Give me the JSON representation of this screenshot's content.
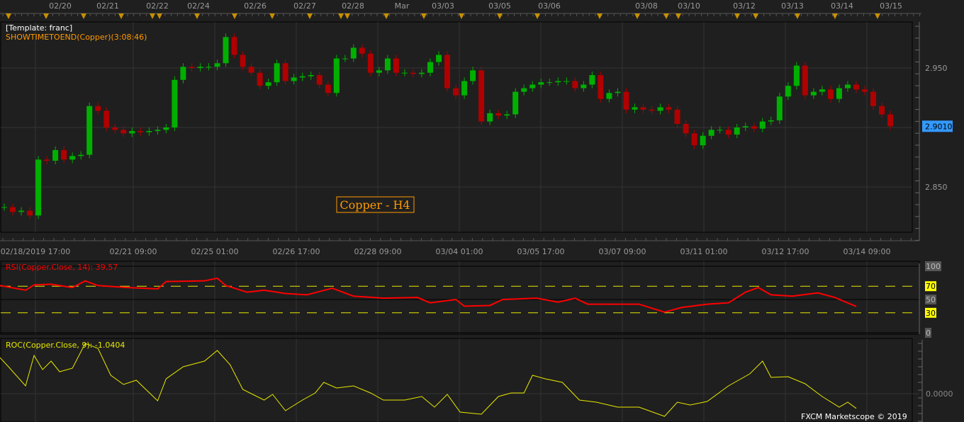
{
  "template_label": "[Template: franc]",
  "timer_label": "SHOWTIMETOEND(Copper)(3:08:46)",
  "chart_title": "Copper - H4",
  "copyright": "FXCM Marketscope © 2019",
  "colors": {
    "background": "#1f1f1f",
    "up": "#00b000",
    "down": "#b00000",
    "rsi": "#ff0000",
    "roc": "#e8e800",
    "level": "#e8e800",
    "price_tag": "#3399ff",
    "title": "#ff9900"
  },
  "top_dates": [
    "02/20",
    "02/21",
    "02/22",
    "02/24",
    "02/26",
    "02/27",
    "02/28",
    "Mar",
    "03/03",
    "03/05",
    "03/06",
    "03/08",
    "03/10",
    "03/12",
    "03/13",
    "03/14",
    "03/15"
  ],
  "chart_data": [
    {
      "type": "candlestick",
      "symbol": "Copper",
      "timeframe": "H4",
      "y_ticks": [
        "2.950",
        "2.900",
        "2.850"
      ],
      "ylim": [
        2.815,
        2.99
      ],
      "last_price": "2.9010",
      "x_labels": [
        "02/18/2019 17:00",
        "02/21 09:00",
        "02/25 01:00",
        "02/26 17:00",
        "02/28 09:00",
        "03/04 01:00",
        "03/05 17:00",
        "03/07 09:00",
        "03/11 01:00",
        "03/12 17:00",
        "03/14 09:00"
      ],
      "first_open": 2.833,
      "closes": [
        2.833,
        2.829,
        2.83,
        2.826,
        2.873,
        2.872,
        2.881,
        2.873,
        2.876,
        2.877,
        2.918,
        2.914,
        2.9,
        2.898,
        2.895,
        2.897,
        2.896,
        2.897,
        2.898,
        2.9,
        2.94,
        2.951,
        2.95,
        2.951,
        2.951,
        2.954,
        2.976,
        2.961,
        2.951,
        2.946,
        2.935,
        2.938,
        2.954,
        2.939,
        2.942,
        2.943,
        2.944,
        2.936,
        2.929,
        2.958,
        2.958,
        2.967,
        2.962,
        2.946,
        2.948,
        2.958,
        2.946,
        2.946,
        2.945,
        2.946,
        2.955,
        2.961,
        2.933,
        2.927,
        2.939,
        2.948,
        2.905,
        2.912,
        2.91,
        2.911,
        2.93,
        2.933,
        2.936,
        2.938,
        2.938,
        2.939,
        2.939,
        2.933,
        2.936,
        2.944,
        2.924,
        2.929,
        2.93,
        2.915,
        2.917,
        2.915,
        2.914,
        2.917,
        2.915,
        2.903,
        2.895,
        2.885,
        2.893,
        2.898,
        2.898,
        2.894,
        2.9,
        2.901,
        2.899,
        2.905,
        2.906,
        2.926,
        2.935,
        2.952,
        2.927,
        2.93,
        2.932,
        2.924,
        2.933,
        2.936,
        2.932,
        2.93,
        2.918,
        2.911,
        2.901
      ]
    },
    {
      "type": "line",
      "label": "RSI(Copper.Close, 14): 39.57",
      "y_ticks": [
        "100",
        "70",
        "50",
        "30",
        "0"
      ],
      "ylim": [
        0,
        100
      ],
      "levels": [
        70,
        30
      ],
      "points": [
        [
          -0.5,
          71
        ],
        [
          2.5,
          64
        ],
        [
          3.5,
          72
        ],
        [
          5.5,
          73
        ],
        [
          8,
          68
        ],
        [
          9.5,
          78
        ],
        [
          11,
          71
        ],
        [
          14.5,
          68
        ],
        [
          18,
          66
        ],
        [
          19,
          77
        ],
        [
          23.5,
          78
        ],
        [
          25,
          82
        ],
        [
          26,
          71
        ],
        [
          28.5,
          61
        ],
        [
          30.5,
          64
        ],
        [
          33,
          59
        ],
        [
          35.5,
          57
        ],
        [
          38.5,
          67
        ],
        [
          41,
          55
        ],
        [
          44.5,
          52
        ],
        [
          48.5,
          53
        ],
        [
          50,
          45
        ],
        [
          53,
          50
        ],
        [
          54,
          40
        ],
        [
          57,
          41
        ],
        [
          58.5,
          50
        ],
        [
          62.5,
          52
        ],
        [
          65,
          46
        ],
        [
          67,
          52
        ],
        [
          68.5,
          43
        ],
        [
          74.5,
          43
        ],
        [
          77.5,
          31
        ],
        [
          79.5,
          38
        ],
        [
          82.5,
          43
        ],
        [
          85,
          45
        ],
        [
          87,
          61
        ],
        [
          88.5,
          68
        ],
        [
          90,
          57
        ],
        [
          92.5,
          55
        ],
        [
          95.5,
          60
        ],
        [
          97.5,
          53
        ],
        [
          100,
          39.57
        ]
      ]
    },
    {
      "type": "line",
      "label": "ROC(Copper.Close, 9): -1.0404",
      "y_ticks": [
        "0.0000"
      ],
      "ylim": [
        -2.0,
        3.9
      ],
      "points": [
        [
          -0.5,
          2.55
        ],
        [
          0.5,
          1.9
        ],
        [
          2.5,
          0.55
        ],
        [
          3.5,
          2.7
        ],
        [
          4.5,
          1.7
        ],
        [
          5.5,
          2.3
        ],
        [
          6.5,
          1.55
        ],
        [
          8,
          1.8
        ],
        [
          9.5,
          3.55
        ],
        [
          11,
          3.2
        ],
        [
          12.5,
          1.3
        ],
        [
          14,
          0.65
        ],
        [
          15.5,
          0.95
        ],
        [
          18,
          -0.5
        ],
        [
          19,
          1.05
        ],
        [
          21,
          1.9
        ],
        [
          23.5,
          2.3
        ],
        [
          25,
          3.05
        ],
        [
          26.5,
          2.05
        ],
        [
          28,
          0.3
        ],
        [
          30.5,
          -0.45
        ],
        [
          31.5,
          -0.05
        ],
        [
          33,
          -1.2
        ],
        [
          35,
          -0.45
        ],
        [
          36.5,
          0.05
        ],
        [
          37.5,
          0.8
        ],
        [
          39,
          0.4
        ],
        [
          41,
          0.55
        ],
        [
          43,
          0.05
        ],
        [
          44.5,
          -0.45
        ],
        [
          47,
          -0.45
        ],
        [
          49,
          -0.2
        ],
        [
          50.5,
          -0.95
        ],
        [
          52,
          -0.05
        ],
        [
          53.5,
          -1.3
        ],
        [
          56,
          -1.45
        ],
        [
          58,
          -0.2
        ],
        [
          59.5,
          0.05
        ],
        [
          61,
          0.05
        ],
        [
          62,
          1.3
        ],
        [
          63.5,
          1.05
        ],
        [
          65.5,
          0.8
        ],
        [
          67.5,
          -0.45
        ],
        [
          69.5,
          -0.6
        ],
        [
          72,
          -0.95
        ],
        [
          74.5,
          -0.95
        ],
        [
          77.5,
          -1.6
        ],
        [
          79,
          -0.6
        ],
        [
          80.5,
          -0.8
        ],
        [
          82.5,
          -0.55
        ],
        [
          85,
          0.55
        ],
        [
          87.5,
          1.4
        ],
        [
          89,
          2.3
        ],
        [
          90,
          1.15
        ],
        [
          92,
          1.2
        ],
        [
          94,
          0.7
        ],
        [
          96,
          -0.2
        ],
        [
          98,
          -0.95
        ],
        [
          99,
          -0.6
        ],
        [
          100,
          -1.0404
        ]
      ]
    }
  ]
}
